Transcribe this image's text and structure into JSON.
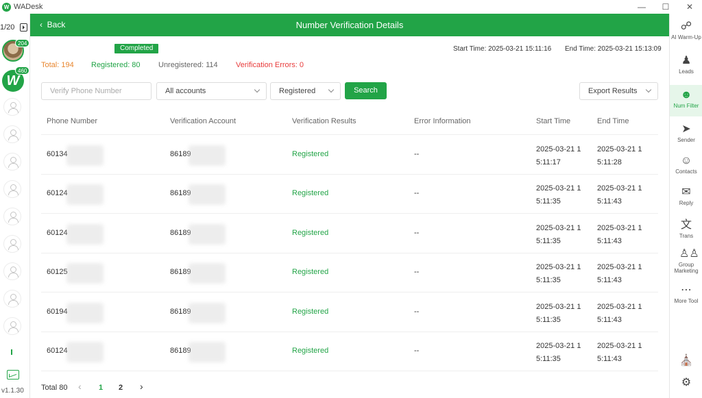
{
  "app": {
    "title": "WADesk",
    "logo_letter": "W",
    "version": "v1.1.30"
  },
  "sidebar_left": {
    "counter": "1/20",
    "accounts": [
      {
        "badge": "204"
      },
      {
        "badge": "460",
        "letter": "W"
      }
    ]
  },
  "header": {
    "back_label": "Back",
    "title": "Number Verification Details"
  },
  "task": {
    "status": "Completed",
    "start_time": "Start Time: 2025-03-21 15:11:16",
    "end_time": "End Time: 2025-03-21 15:13:09",
    "total": "Total: 194",
    "registered": "Registered: 80",
    "unregistered": "Unregistered: 114",
    "errors": "Verification Errors: 0"
  },
  "filters": {
    "phone_placeholder": "Verify Phone Number",
    "account_select": "All accounts",
    "status_select": "Registered",
    "search_label": "Search",
    "export_label": "Export Results"
  },
  "table": {
    "headers": [
      "Phone Number",
      "Verification Account",
      "Verification Results",
      "Error Information",
      "Start Time",
      "End Time"
    ],
    "rows": [
      {
        "phone": "60134",
        "account": "86189",
        "result": "Registered",
        "error": "--",
        "start": "2025-03-21 15:11:17",
        "end": "2025-03-21 15:11:28"
      },
      {
        "phone": "60124",
        "account": "86189",
        "result": "Registered",
        "error": "--",
        "start": "2025-03-21 15:11:35",
        "end": "2025-03-21 15:11:43"
      },
      {
        "phone": "60124",
        "account": "86189",
        "result": "Registered",
        "error": "--",
        "start": "2025-03-21 15:11:35",
        "end": "2025-03-21 15:11:43"
      },
      {
        "phone": "60125",
        "account": "86189",
        "result": "Registered",
        "error": "--",
        "start": "2025-03-21 15:11:35",
        "end": "2025-03-21 15:11:43"
      },
      {
        "phone": "60194",
        "account": "86189",
        "result": "Registered",
        "error": "--",
        "start": "2025-03-21 15:11:35",
        "end": "2025-03-21 15:11:43"
      },
      {
        "phone": "60124",
        "account": "86189",
        "result": "Registered",
        "error": "--",
        "start": "2025-03-21 15:11:35",
        "end": "2025-03-21 15:11:43"
      }
    ]
  },
  "pagination": {
    "total": "Total 80",
    "pages": [
      "1",
      "2"
    ],
    "prev": "‹",
    "next": "›"
  },
  "sidebar_right": {
    "items": [
      {
        "label": "AI Warm-Up",
        "icon": "share-nodes-icon"
      },
      {
        "label": "Leads",
        "icon": "leads-icon"
      },
      {
        "label": "Num Filter",
        "icon": "num-filter-icon"
      },
      {
        "label": "Sender",
        "icon": "paper-plane-icon"
      },
      {
        "label": "Contacts",
        "icon": "contacts-icon"
      },
      {
        "label": "Reply",
        "icon": "chat-bubble-icon"
      },
      {
        "label": "Trans",
        "icon": "translate-icon"
      },
      {
        "label": "Group Marketing",
        "icon": "group-icon"
      },
      {
        "label": "More Tool",
        "icon": "ellipsis-icon"
      }
    ]
  },
  "colors": {
    "accent": "#22a447",
    "total": "#e8852d",
    "unregistered": "#666666",
    "error": "#e83b3b"
  }
}
